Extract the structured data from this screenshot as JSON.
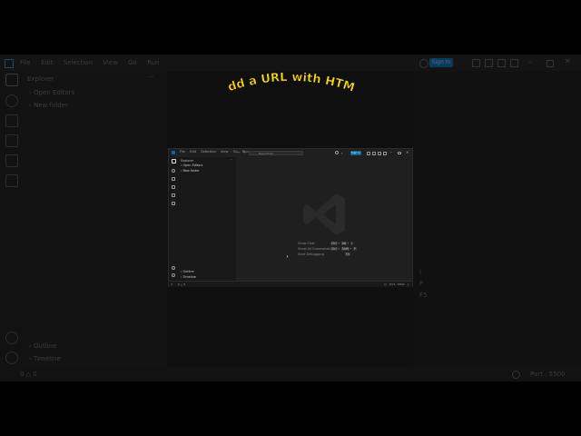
{
  "headline": "Add a URL with HTML",
  "colors": {
    "headline": "#f5d90a",
    "accent": "#0e639c",
    "editor_bg": "#1f1f1f"
  },
  "background_editor": {
    "menu": [
      "File",
      "Edit",
      "Selection",
      "View",
      "Go",
      "Run"
    ],
    "sidebar_title": "Explorer",
    "sections": [
      "Open Editors",
      "New folder"
    ],
    "bottom_sections": [
      "Outline",
      "Timeline"
    ],
    "sign_in": "Sign In",
    "status_left": "0 △ 0",
    "status_right": "Port : 5500"
  },
  "inner_window": {
    "menu": [
      "File",
      "Edit",
      "Selection",
      "View",
      "Go",
      "Run"
    ],
    "search_placeholder": "New folder",
    "sign_in": "Sign In",
    "sidebar_title": "Explorer",
    "sections": [
      "Open Editors",
      "New folder"
    ],
    "bottom_sections": [
      "Outline",
      "Timeline"
    ],
    "shortcuts": [
      {
        "label": "Show Chat",
        "keys": [
          "Ctrl",
          "Alt",
          "I"
        ]
      },
      {
        "label": "Show All Commands",
        "keys": [
          "Ctrl",
          "Shift",
          "P"
        ]
      },
      {
        "label": "Start Debugging",
        "keys": [
          "F5"
        ]
      }
    ],
    "status_left": "0 △ 0",
    "status_right": "Port : 5500"
  }
}
